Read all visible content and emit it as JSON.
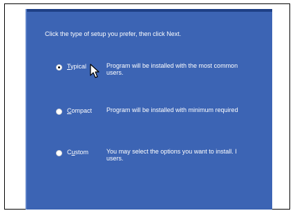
{
  "instruction": "Click the type of setup you prefer, then click Next.",
  "options": [
    {
      "accel": "T",
      "rest": "ypical",
      "selected": true,
      "desc_line1": "Program will be installed with the most common",
      "desc_line2": "users."
    },
    {
      "accel": "C",
      "rest": "ompact",
      "selected": false,
      "desc_line1": "Program will be installed with minimum required",
      "desc_line2": ""
    },
    {
      "pre": "C",
      "accel": "u",
      "rest": "stom",
      "selected": false,
      "desc_line1": "You may select the options you want to install. I",
      "desc_line2": "users."
    }
  ],
  "colors": {
    "panel": "#3c64b4",
    "text": "#ffffff"
  },
  "icons": {
    "cursor": "arrow-cursor-icon"
  }
}
